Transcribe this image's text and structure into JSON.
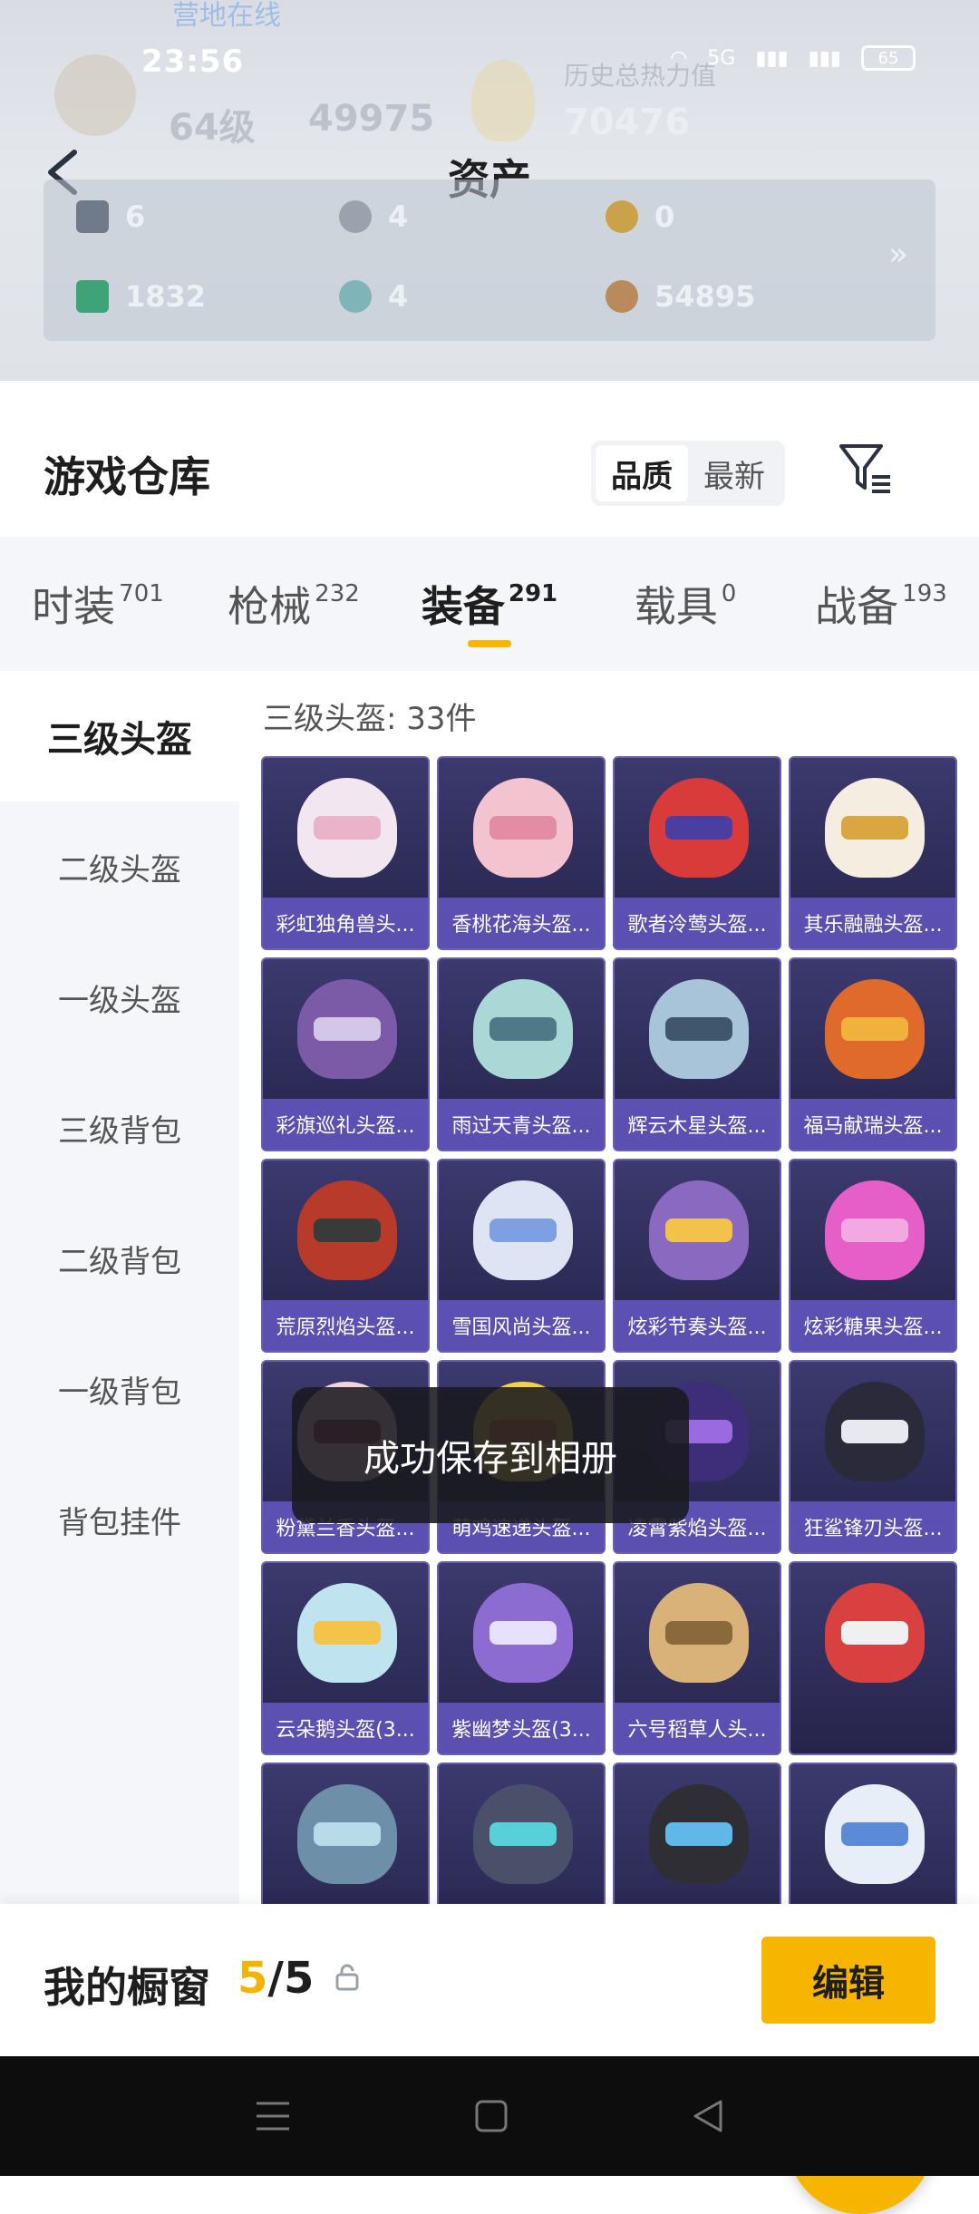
{
  "status": {
    "time": "23:56",
    "battery": "65",
    "network": "5G"
  },
  "header": {
    "title": "资产",
    "bg_online": "营地在线",
    "bg_level": "64级",
    "bg_score": "49975",
    "bg_history_label": "历史总热力值",
    "bg_heat": "70476"
  },
  "assets": [
    {
      "value": "6",
      "color": "#6f7a8a"
    },
    {
      "value": "4",
      "color": "#9aa3ad"
    },
    {
      "value": "0",
      "color": "#c9a24a"
    },
    {
      "value": "1832",
      "color": "#3fa37a"
    },
    {
      "value": "4",
      "color": "#7fb4b8"
    },
    {
      "value": "54895",
      "color": "#b98a5a"
    }
  ],
  "warehouse": {
    "title": "游戏仓库",
    "sort_options": [
      "品质",
      "最新"
    ],
    "active_sort": "品质"
  },
  "tabs": [
    {
      "label": "时装",
      "count": "701"
    },
    {
      "label": "枪械",
      "count": "232"
    },
    {
      "label": "装备",
      "count": "291",
      "active": true
    },
    {
      "label": "载具",
      "count": "0"
    },
    {
      "label": "战备",
      "count": "193"
    }
  ],
  "categories": [
    "三级头盔",
    "二级头盔",
    "一级头盔",
    "三级背包",
    "二级背包",
    "一级背包",
    "背包挂件"
  ],
  "grid_title": "三级头盔: 33件",
  "items": [
    {
      "label": "彩虹独角兽头...",
      "helm": "#f2e6f0",
      "visor": "#e9b4c8"
    },
    {
      "label": "香桃花海头盔...",
      "helm": "#f3c4cf",
      "visor": "#e28da3"
    },
    {
      "label": "歌者泠莺头盔...",
      "helm": "#d93a3a",
      "visor": "#4a3fa0"
    },
    {
      "label": "其乐融融头盔...",
      "helm": "#f4ede0",
      "visor": "#d9a642"
    },
    {
      "label": "彩旗巡礼头盔...",
      "helm": "#7b5aa8",
      "visor": "#d4c6e6"
    },
    {
      "label": "雨过天青头盔...",
      "helm": "#a9d8d6",
      "visor": "#4d7a86"
    },
    {
      "label": "辉云木星头盔...",
      "helm": "#a7c4d8",
      "visor": "#3f566c"
    },
    {
      "label": "福马献瑞头盔...",
      "helm": "#e06a2c",
      "visor": "#f0b23c"
    },
    {
      "label": "荒原烈焰头盔...",
      "helm": "#b83a2a",
      "visor": "#3a3a3a"
    },
    {
      "label": "雪国风尚头盔...",
      "helm": "#dfe4f4",
      "visor": "#7fa0e0"
    },
    {
      "label": "炫彩节奏头盔...",
      "helm": "#8a6ac0",
      "visor": "#f2c24a"
    },
    {
      "label": "炫彩糖果头盔...",
      "helm": "#e65ec7",
      "visor": "#f2a8e0"
    },
    {
      "label": "粉黛兰香头盔...",
      "helm": "#f1d3da",
      "visor": "#a04a5a"
    },
    {
      "label": "萌鸡速递头盔...",
      "helm": "#f5d14a",
      "visor": "#f08a4a"
    },
    {
      "label": "凌霄紫焰头盔...",
      "helm": "#3e2e7a",
      "visor": "#9a6ae0"
    },
    {
      "label": "狂鲨锋刃头盔...",
      "helm": "#2a2a3a",
      "visor": "#e8e8ef"
    },
    {
      "label": "云朵鹅头盔(3...",
      "helm": "#bfe3ef",
      "visor": "#f3c34a"
    },
    {
      "label": "紫幽梦头盔(3...",
      "helm": "#8c6cd0",
      "visor": "#e8e0ff"
    },
    {
      "label": "六号稻草人头...",
      "helm": "#d9b27a",
      "visor": "#8a6a3a"
    },
    {
      "label": "",
      "helm": "#d94040",
      "visor": "#f0f0f0"
    },
    {
      "label": "",
      "helm": "#6d8fa8",
      "visor": "#b9dbe8"
    },
    {
      "label": "",
      "helm": "#4a4f6a",
      "visor": "#58d0d8"
    },
    {
      "label": "",
      "helm": "#2e2e34",
      "visor": "#60b8e8"
    },
    {
      "label": "",
      "helm": "#e8eef8",
      "visor": "#5a8ad8"
    }
  ],
  "toast": "成功保存到相册",
  "showcase": {
    "label": "我的橱窗",
    "current": "5",
    "total": "/5",
    "edit": "编辑"
  }
}
